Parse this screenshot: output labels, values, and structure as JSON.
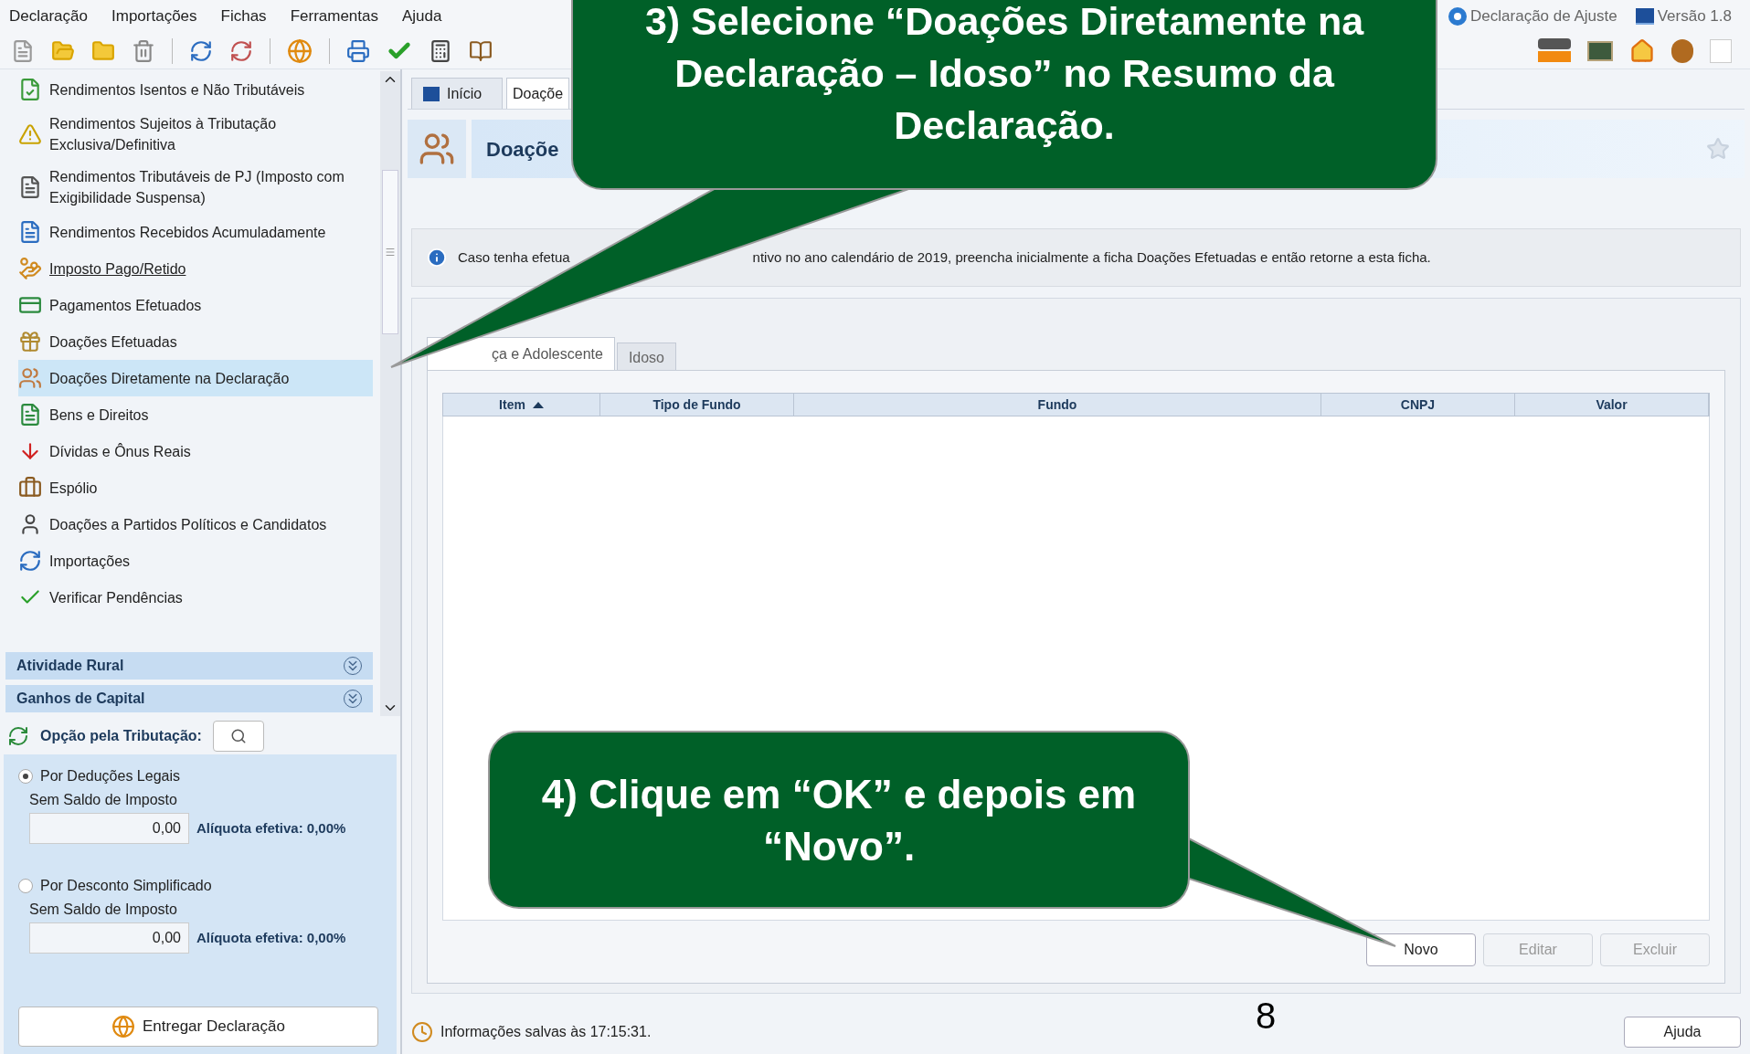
{
  "menu": [
    "Declaração",
    "Importações",
    "Fichas",
    "Ferramentas",
    "Ajuda"
  ],
  "header": {
    "mode": "Declaração de Ajuste",
    "version": "Versão 1.8"
  },
  "sidebar": {
    "items": [
      {
        "label": "Rendimentos Isentos e Não Tributáveis",
        "selected": false,
        "underlined": false
      },
      {
        "label": "Rendimentos Sujeitos à Tributação Exclusiva/Definitiva",
        "selected": false,
        "underlined": false
      },
      {
        "label": "Rendimentos Tributáveis de PJ (Imposto com Exigibilidade Suspensa)",
        "selected": false,
        "underlined": false
      },
      {
        "label": "Rendimentos Recebidos Acumuladamente",
        "selected": false,
        "underlined": false
      },
      {
        "label": "Imposto Pago/Retido",
        "selected": false,
        "underlined": true
      },
      {
        "label": "Pagamentos Efetuados",
        "selected": false,
        "underlined": false
      },
      {
        "label": "Doações Efetuadas",
        "selected": false,
        "underlined": false
      },
      {
        "label": "Doações Diretamente na Declaração",
        "selected": true,
        "underlined": false
      },
      {
        "label": "Bens e Direitos",
        "selected": false,
        "underlined": false
      },
      {
        "label": "Dívidas e Ônus Reais",
        "selected": false,
        "underlined": false
      },
      {
        "label": "Espólio",
        "selected": false,
        "underlined": false
      },
      {
        "label": "Doações a Partidos Políticos e Candidatos",
        "selected": false,
        "underlined": false
      },
      {
        "label": "Importações",
        "selected": false,
        "underlined": false
      },
      {
        "label": "Verificar Pendências",
        "selected": false,
        "underlined": false
      }
    ],
    "sections": [
      {
        "label": "Atividade Rural",
        "expanded": false
      },
      {
        "label": "Ganhos de Capital",
        "expanded": false
      }
    ]
  },
  "tax_option": {
    "title": "Opção pela Tributação:",
    "options": [
      {
        "label": "Por Deduções Legais",
        "selected": true,
        "status": "Sem Saldo de Imposto",
        "value": "0,00",
        "rate": "Alíquota efetiva: 0,00%"
      },
      {
        "label": "Por Desconto Simplificado",
        "selected": false,
        "status": "Sem Saldo de Imposto",
        "value": "0,00",
        "rate": "Alíquota efetiva: 0,00%"
      }
    ],
    "deliver_button": "Entregar Declaração"
  },
  "tabs": [
    {
      "label": "Início",
      "selected": false
    },
    {
      "label": "Doaçõe",
      "selected": true
    }
  ],
  "page_title": "Doaçõe",
  "info": {
    "part_1": "Caso tenha efetua",
    "part_2": "ntivo no ano calendário de 2019, preencha inicialmente a ficha Doações Efetuadas e então retorne a esta ficha."
  },
  "subtabs": [
    {
      "label": "ça e Adolescente",
      "selected": true
    },
    {
      "label": "Idoso",
      "selected": false
    }
  ],
  "table": {
    "columns": [
      {
        "label": "Item",
        "sorted": true
      },
      {
        "label": "Tipo de Fundo",
        "sorted": false
      },
      {
        "label": "Fundo",
        "sorted": false
      },
      {
        "label": "CNPJ",
        "sorted": false
      },
      {
        "label": "Valor",
        "sorted": false
      }
    ]
  },
  "buttons": [
    {
      "label": "Novo",
      "disabled": false
    },
    {
      "label": "Editar",
      "disabled": true
    },
    {
      "label": "Excluir",
      "disabled": true
    }
  ],
  "status": "Informações salvas às 17:15:31.",
  "help_button": "Ajuda",
  "page_number": "8",
  "callouts": [
    {
      "text": "3) Selecione “Doações Diretamente na Declaração – Idoso” no Resumo da Declaração."
    },
    {
      "text": "4) Clique em “OK” e depois em “Novo”."
    }
  ]
}
